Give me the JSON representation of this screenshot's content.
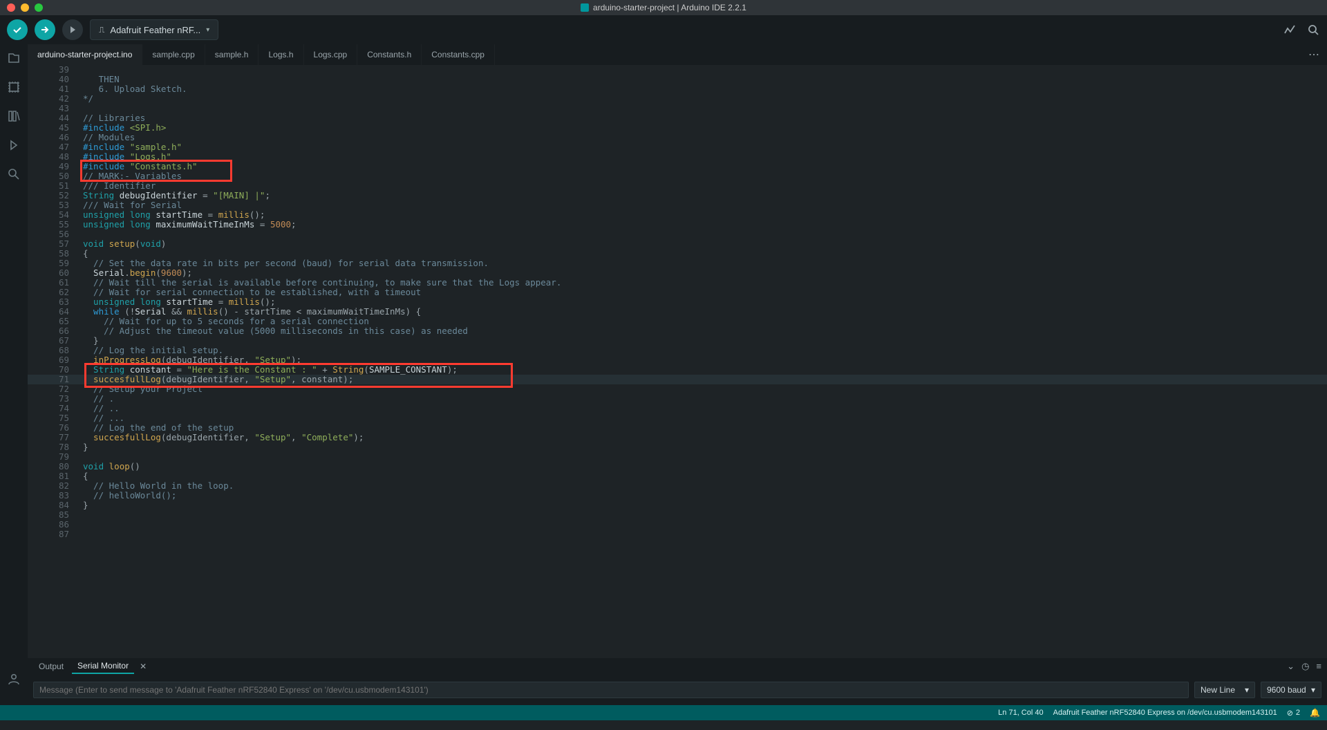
{
  "title": "arduino-starter-project | Arduino IDE 2.2.1",
  "board_selector": "Adafruit Feather nRF...",
  "tabs": [
    "arduino-starter-project.ino",
    "sample.cpp",
    "sample.h",
    "Logs.h",
    "Logs.cpp",
    "Constants.h",
    "Constants.cpp"
  ],
  "active_tab_index": 0,
  "code_first_line_no": 39,
  "code_lines": [
    [
      [
        "",
        ""
      ]
    ],
    [
      [
        "c-comment",
        "   THEN"
      ]
    ],
    [
      [
        "c-comment",
        "   6. Upload Sketch."
      ]
    ],
    [
      [
        "c-comment",
        "*/"
      ]
    ],
    [
      [
        "",
        ""
      ]
    ],
    [
      [
        "c-comment",
        "// Libraries"
      ]
    ],
    [
      [
        "c-keyword",
        "#include "
      ],
      [
        "c-string",
        "<SPI.h>"
      ]
    ],
    [
      [
        "c-comment",
        "// Modules"
      ]
    ],
    [
      [
        "c-keyword",
        "#include "
      ],
      [
        "c-string",
        "\"sample.h\""
      ]
    ],
    [
      [
        "c-keyword",
        "#include "
      ],
      [
        "c-string",
        "\"Logs.h\""
      ]
    ],
    [
      [
        "c-keyword",
        "#include "
      ],
      [
        "c-string",
        "\"Constants.h\""
      ]
    ],
    [
      [
        "c-comment",
        "// MARK:- Variables"
      ]
    ],
    [
      [
        "c-comment",
        "/// Identifier"
      ]
    ],
    [
      [
        "c-type",
        "String "
      ],
      [
        "c-ident",
        "debugIdentifier "
      ],
      [
        "c-punct",
        "= "
      ],
      [
        "c-string",
        "\"[MAIN] |\""
      ],
      [
        "c-punct",
        ";"
      ]
    ],
    [
      [
        "c-comment",
        "/// Wait for Serial"
      ]
    ],
    [
      [
        "c-type",
        "unsigned long "
      ],
      [
        "c-ident",
        "startTime "
      ],
      [
        "c-punct",
        "= "
      ],
      [
        "c-func",
        "millis"
      ],
      [
        "c-punct",
        "();"
      ]
    ],
    [
      [
        "c-type",
        "unsigned long "
      ],
      [
        "c-ident",
        "maximumWaitTimeInMs "
      ],
      [
        "c-punct",
        "= "
      ],
      [
        "c-number",
        "5000"
      ],
      [
        "c-punct",
        ";"
      ]
    ],
    [
      [
        "",
        ""
      ]
    ],
    [
      [
        "c-type",
        "void "
      ],
      [
        "c-func",
        "setup"
      ],
      [
        "c-punct",
        "("
      ],
      [
        "c-type",
        "void"
      ],
      [
        "c-punct",
        ")"
      ]
    ],
    [
      [
        "c-punct",
        "{"
      ]
    ],
    [
      [
        "c-comment",
        "  // Set the data rate in bits per second (baud) for serial data transmission."
      ]
    ],
    [
      [
        "c-ident",
        "  Serial"
      ],
      [
        "c-punct",
        "."
      ],
      [
        "c-func",
        "begin"
      ],
      [
        "c-punct",
        "("
      ],
      [
        "c-number",
        "9600"
      ],
      [
        "c-punct",
        ");"
      ]
    ],
    [
      [
        "c-comment",
        "  // Wait till the serial is available before continuing, to make sure that the Logs appear."
      ]
    ],
    [
      [
        "c-comment",
        "  // Wait for serial connection to be established, with a timeout"
      ]
    ],
    [
      [
        "c-type",
        "  unsigned long "
      ],
      [
        "c-ident",
        "startTime "
      ],
      [
        "c-punct",
        "= "
      ],
      [
        "c-func",
        "millis"
      ],
      [
        "c-punct",
        "();"
      ]
    ],
    [
      [
        "c-keyword",
        "  while "
      ],
      [
        "c-punct",
        "(!"
      ],
      [
        "c-ident",
        "Serial "
      ],
      [
        "c-punct",
        "&& "
      ],
      [
        "c-func",
        "millis"
      ],
      [
        "c-punct",
        "() - startTime < maximumWaitTimeInMs) {"
      ]
    ],
    [
      [
        "c-comment",
        "    // Wait for up to 5 seconds for a serial connection"
      ]
    ],
    [
      [
        "c-comment",
        "    // Adjust the timeout value (5000 milliseconds in this case) as needed"
      ]
    ],
    [
      [
        "c-punct",
        "  }"
      ]
    ],
    [
      [
        "c-comment",
        "  // Log the initial setup."
      ]
    ],
    [
      [
        "c-func",
        "  inProgressLog"
      ],
      [
        "c-punct",
        "(debugIdentifier, "
      ],
      [
        "c-string",
        "\"Setup\""
      ],
      [
        "c-punct",
        ");"
      ]
    ],
    [
      [
        "c-type",
        "  String "
      ],
      [
        "c-ident",
        "constant "
      ],
      [
        "c-punct",
        "= "
      ],
      [
        "c-string",
        "\"Here is the Constant : \""
      ],
      [
        "c-punct",
        " + "
      ],
      [
        "c-func",
        "String"
      ],
      [
        "c-punct",
        "("
      ],
      [
        "c-ident",
        "SAMPLE_CONSTANT"
      ],
      [
        "c-punct",
        ");"
      ]
    ],
    [
      [
        "c-func",
        "  succesfullLog"
      ],
      [
        "c-punct",
        "(debugIdentifier, "
      ],
      [
        "c-string",
        "\"Setup\""
      ],
      [
        "c-punct",
        ", constant);"
      ]
    ],
    [
      [
        "c-comment",
        "  // Setup your Project"
      ]
    ],
    [
      [
        "c-comment",
        "  // ."
      ]
    ],
    [
      [
        "c-comment",
        "  // .."
      ]
    ],
    [
      [
        "c-comment",
        "  // ..."
      ]
    ],
    [
      [
        "c-comment",
        "  // Log the end of the setup"
      ]
    ],
    [
      [
        "c-func",
        "  succesfullLog"
      ],
      [
        "c-punct",
        "(debugIdentifier, "
      ],
      [
        "c-string",
        "\"Setup\""
      ],
      [
        "c-punct",
        ", "
      ],
      [
        "c-string",
        "\"Complete\""
      ],
      [
        "c-punct",
        ");"
      ]
    ],
    [
      [
        "c-punct",
        "}"
      ]
    ],
    [
      [
        "",
        ""
      ]
    ],
    [
      [
        "c-type",
        "void "
      ],
      [
        "c-func",
        "loop"
      ],
      [
        "c-punct",
        "()"
      ]
    ],
    [
      [
        "c-punct",
        "{"
      ]
    ],
    [
      [
        "c-comment",
        "  // Hello World in the loop."
      ]
    ],
    [
      [
        "c-comment",
        "  // helloWorld();"
      ]
    ],
    [
      [
        "c-punct",
        "}"
      ]
    ],
    [
      [
        "",
        ""
      ]
    ],
    [
      [
        "",
        ""
      ]
    ],
    [
      [
        "",
        ""
      ]
    ]
  ],
  "cursor_line_no": 71,
  "bottom_tabs": {
    "output": "Output",
    "serial": "Serial Monitor"
  },
  "serial_placeholder": "Message (Enter to send message to 'Adafruit Feather nRF52840 Express' on '/dev/cu.usbmodem143101')",
  "line_ending": "New Line",
  "baud": "9600 baud",
  "status": {
    "pos": "Ln 71, Col 40",
    "port": "Adafruit Feather nRF52840 Express on /dev/cu.usbmodem143101",
    "notif_count": "2"
  }
}
